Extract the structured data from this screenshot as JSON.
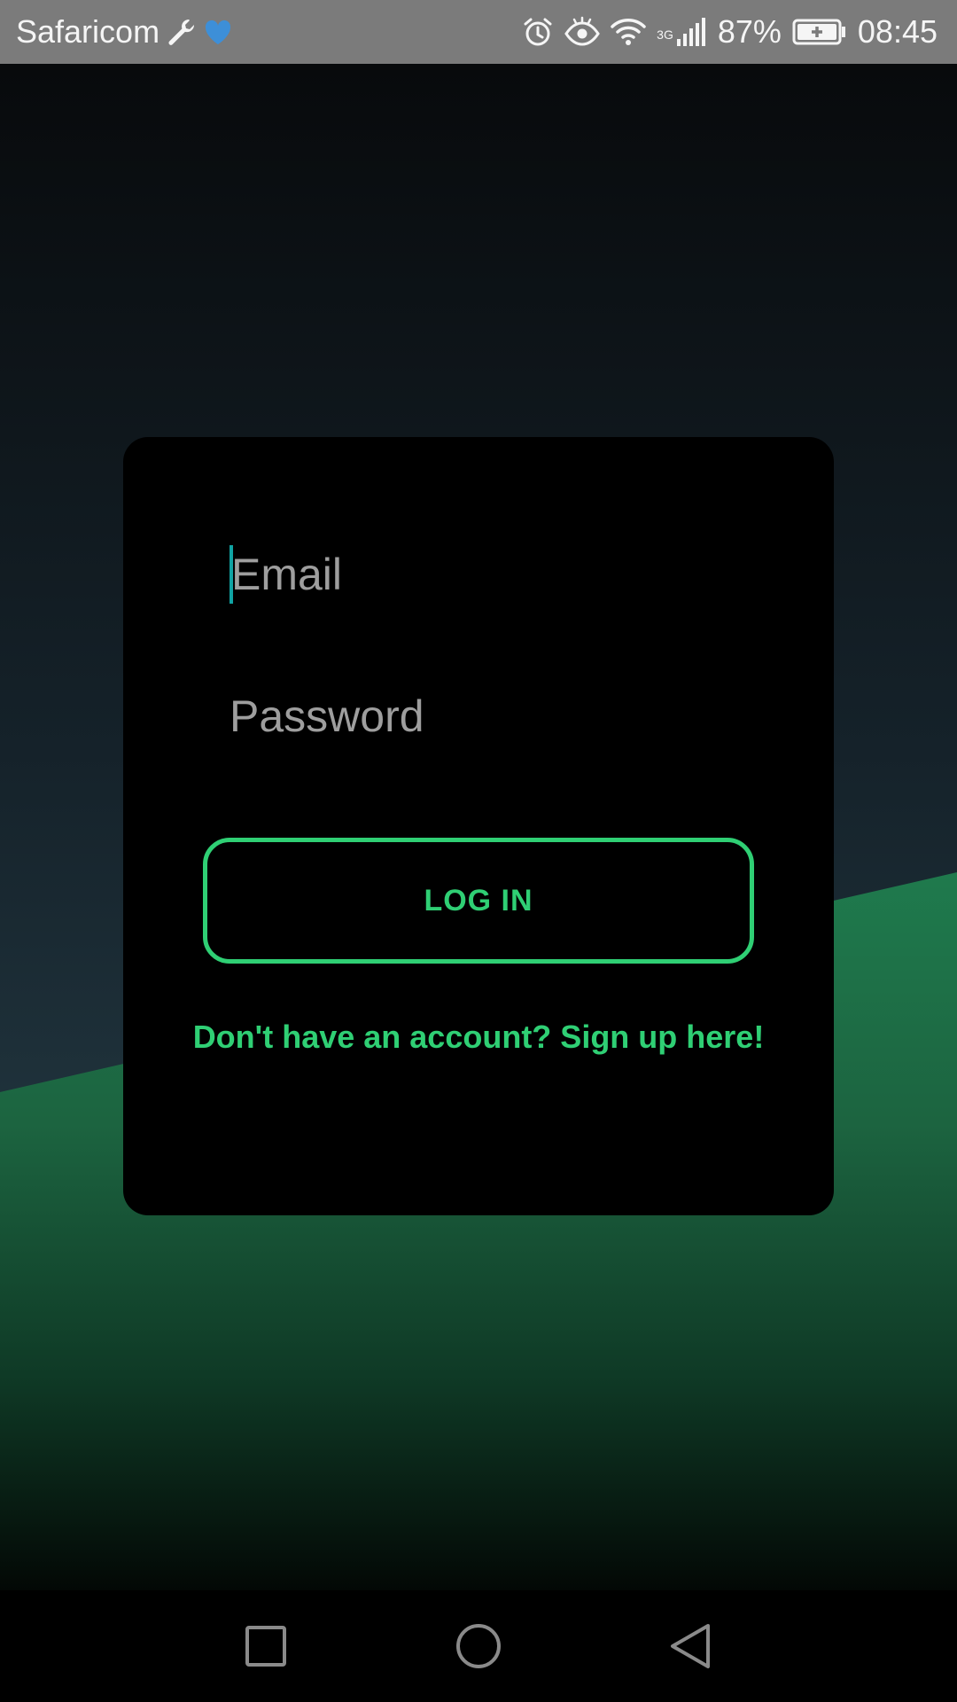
{
  "status_bar": {
    "carrier": "Safaricom",
    "network_type": "3G",
    "battery": "87%",
    "time": "08:45",
    "icons": [
      "wrench-icon",
      "heart-icon",
      "alarm-icon",
      "eye-icon",
      "wifi-icon",
      "signal-icon",
      "battery-charging-icon"
    ],
    "colors": {
      "background": "#7b7b7b",
      "text": "#f5f5f5",
      "heart": "#3d8fd8"
    }
  },
  "login": {
    "email_placeholder": "Email",
    "password_placeholder": "Password",
    "login_button": "LOG IN",
    "signup_link": "Don't have an account? Sign up here!"
  },
  "nav_bar": {
    "buttons": [
      "recents-icon",
      "home-icon",
      "back-icon"
    ]
  },
  "colors": {
    "accent": "#2fcf74",
    "caret": "#10a3a3",
    "card_background": "#000000",
    "placeholder_text": "#9e9e9e",
    "bg_top": "#080a0c",
    "bg_slate": "#2b4650",
    "bg_green": "#1e7349"
  }
}
